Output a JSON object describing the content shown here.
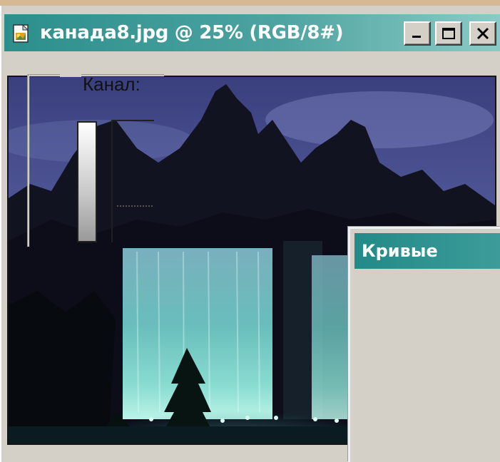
{
  "document_window": {
    "title": "канада8.jpg @ 25% (RGB/8#)",
    "icons": [
      "photoshop-document-icon",
      "minimize-icon",
      "maximize-icon",
      "close-icon"
    ],
    "titlebar_color": "#3a9a96"
  },
  "curves_dialog": {
    "title": "Кривые",
    "channel_label": "Канал:"
  },
  "colors": {
    "window_face": "#d4d0c8",
    "titlebar_start": "#2b8f8c",
    "titlebar_end": "#8ccbc6"
  }
}
